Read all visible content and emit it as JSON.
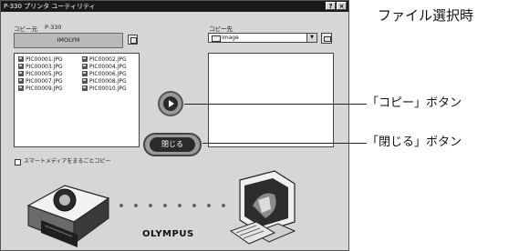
{
  "window": {
    "title": "P-330 プリンタ ユーティリティ",
    "help_button": "?",
    "close_button": "×"
  },
  "source": {
    "label": "コピー元",
    "model": "P-330",
    "device_name": "IMOLYM"
  },
  "files": [
    "PIC00001.JPG",
    "PIC00002.JPG",
    "PIC00003.JPG",
    "PIC00004.JPG",
    "PIC00005.JPG",
    "PIC00006.JPG",
    "PIC00007.JPG",
    "PIC00008.JPG",
    "PIC00009.JPG",
    "PIC00010.JPG"
  ],
  "destination": {
    "label": "コピー先",
    "folder": "Image"
  },
  "buttons": {
    "close_label": "閉じる"
  },
  "checkbox": {
    "label": "スマートメディアをまるごとコピー",
    "checked": false
  },
  "brand": {
    "logo": "OLYMPUS"
  },
  "annotations": {
    "caption": "ファイル選択時",
    "copy_callout": "「コピー」ボタン",
    "close_callout": "「閉じる」ボタン"
  },
  "icons": {
    "copy": "play-arrow-icon",
    "file": "jpg-file-icon",
    "folder": "folder-icon",
    "new_folder": "new-folder-icon",
    "printer": "printer-icon",
    "computer": "computer-icon"
  }
}
